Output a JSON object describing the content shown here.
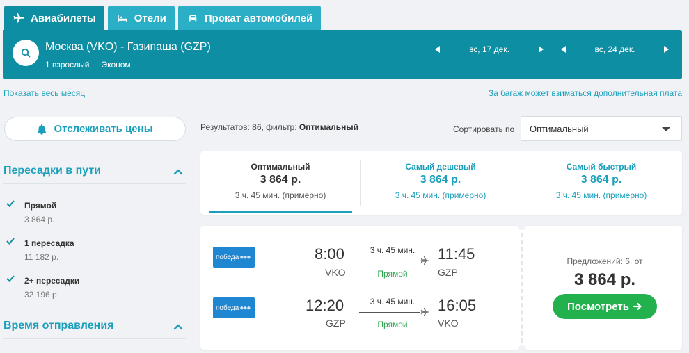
{
  "tabs": [
    {
      "label": "Авиабилеты",
      "icon": "plane-icon",
      "active": true
    },
    {
      "label": "Отели",
      "icon": "bed-icon",
      "active": false
    },
    {
      "label": "Прокат автомобилей",
      "icon": "car-icon",
      "active": false
    }
  ],
  "search": {
    "route": "Москва (VKO) - Газипаша (GZP)",
    "passengers": "1 взрослый",
    "cabin": "Эконом",
    "depart_date": "вс, 17 дек.",
    "return_date": "вс, 24 дек."
  },
  "links": {
    "show_month": "Показать весь месяц",
    "baggage_note": "За багаж может взиматься дополнительная плата"
  },
  "sidebar": {
    "track_prices": "Отслеживать цены",
    "stops_title": "Пересадки в пути",
    "stops": [
      {
        "label": "Прямой",
        "price": "3 864 р.",
        "checked": true
      },
      {
        "label": "1 пересадка",
        "price": "11 182 р.",
        "checked": true
      },
      {
        "label": "2+ пересадки",
        "price": "32 196 р.",
        "checked": true
      }
    ],
    "departure_title": "Время отправления"
  },
  "results": {
    "prefix": "Результатов: 86, фильтр: ",
    "filter": "Оптимальный",
    "sort_label": "Сортировать по",
    "sort_value": "Оптимальный"
  },
  "sort_cards": [
    {
      "title": "Оптимальный",
      "price": "3 864 р.",
      "duration": "3 ч. 45 мин. (примерно)",
      "active": true
    },
    {
      "title": "Самый дешевый",
      "price": "3 864 р.",
      "duration": "3 ч. 45 мин. (примерно)",
      "active": false
    },
    {
      "title": "Самый быстрый",
      "price": "3 864 р.",
      "duration": "3 ч. 45 мин. (примерно)",
      "active": false
    }
  ],
  "flight": {
    "legs": [
      {
        "airline": "победа",
        "dep_time": "8:00",
        "dep_code": "VKO",
        "duration": "3 ч. 45 мин.",
        "stops": "Прямой",
        "arr_time": "11:45",
        "arr_code": "GZP"
      },
      {
        "airline": "победа",
        "dep_time": "12:20",
        "dep_code": "GZP",
        "duration": "3 ч. 45 мин.",
        "stops": "Прямой",
        "arr_time": "16:05",
        "arr_code": "VKO"
      }
    ],
    "offers": "Предложений: 6, от",
    "price": "3 864 р.",
    "view_label": "Посмотреть"
  },
  "colors": {
    "accent": "#1b9fbb",
    "header": "#0e8ea3",
    "tab": "#2aafc7",
    "green": "#23b14d",
    "airline": "#1f86d1"
  }
}
